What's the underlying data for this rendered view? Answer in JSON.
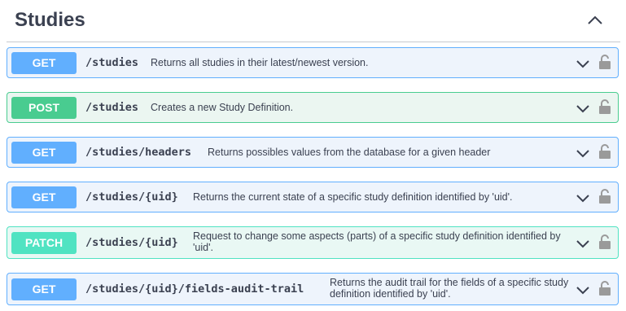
{
  "section": {
    "title": "Studies"
  },
  "operations": [
    {
      "method": "GET",
      "path": "/studies",
      "description": "Returns all studies in their latest/newest version."
    },
    {
      "method": "POST",
      "path": "/studies",
      "description": "Creates a new Study Definition."
    },
    {
      "method": "GET",
      "path": "/studies/headers",
      "description": "Returns possibles values from the database for a given header"
    },
    {
      "method": "GET",
      "path": "/studies/{uid}",
      "description": "Returns the current state of a specific study definition identified by 'uid'."
    },
    {
      "method": "PATCH",
      "path": "/studies/{uid}",
      "description": "Request to change some aspects (parts) of a specific study definition identified by 'uid'."
    },
    {
      "method": "GET",
      "path": "/studies/{uid}/fields-audit-trail",
      "description": "Returns the audit trail for the fields of a specific study definition identified by 'uid'."
    }
  ],
  "icons": {
    "collapse": "chevron-up-icon",
    "expand": "chevron-down-icon",
    "auth": "lock-icon"
  },
  "colors": {
    "get": "#61affe",
    "post": "#49cc90",
    "patch": "#50e3c2"
  }
}
